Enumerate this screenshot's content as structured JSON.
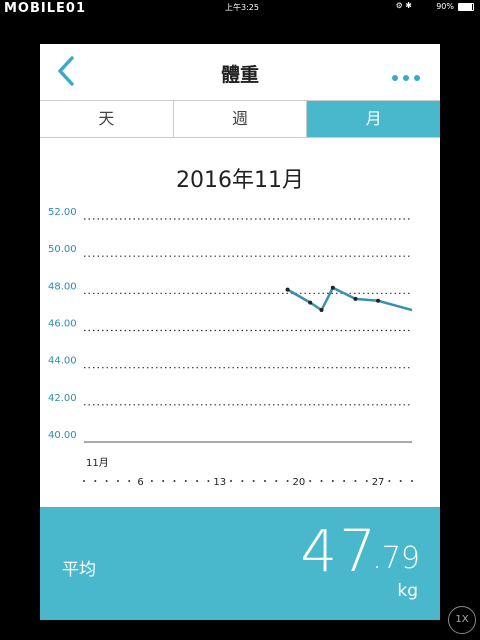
{
  "statusbar": {
    "logo": "MOBILE01",
    "device": "iPad",
    "time": "上午3:25",
    "battery": "90%",
    "battery_level": 0.9
  },
  "header": {
    "title": "體重"
  },
  "tabs": [
    {
      "label": "天",
      "active": false
    },
    {
      "label": "週",
      "active": false
    },
    {
      "label": "月",
      "active": true
    }
  ],
  "period": "2016年11月",
  "chart_data": {
    "type": "line",
    "ylim": [
      40,
      52
    ],
    "yticks": [
      "52.00",
      "50.00",
      "48.00",
      "46.00",
      "44.00",
      "42.00",
      "40.00"
    ],
    "month_label": "11月",
    "x_day_labels": [
      "6",
      "13",
      "20",
      "27"
    ],
    "x_range": [
      1,
      30
    ],
    "points": [
      {
        "x": 19,
        "y": 48.2
      },
      {
        "x": 21,
        "y": 47.5
      },
      {
        "x": 22,
        "y": 47.1
      },
      {
        "x": 23,
        "y": 48.3
      },
      {
        "x": 25,
        "y": 47.7
      },
      {
        "x": 27,
        "y": 47.6
      },
      {
        "x": 30,
        "y": 47.1
      }
    ],
    "color": "#3a8fae",
    "grid": true
  },
  "footer": {
    "label": "平均",
    "value_int": "47",
    "value_dec": ".79",
    "unit": "kg",
    "bg": "#4ab8cc"
  },
  "zoom_button": "1X"
}
